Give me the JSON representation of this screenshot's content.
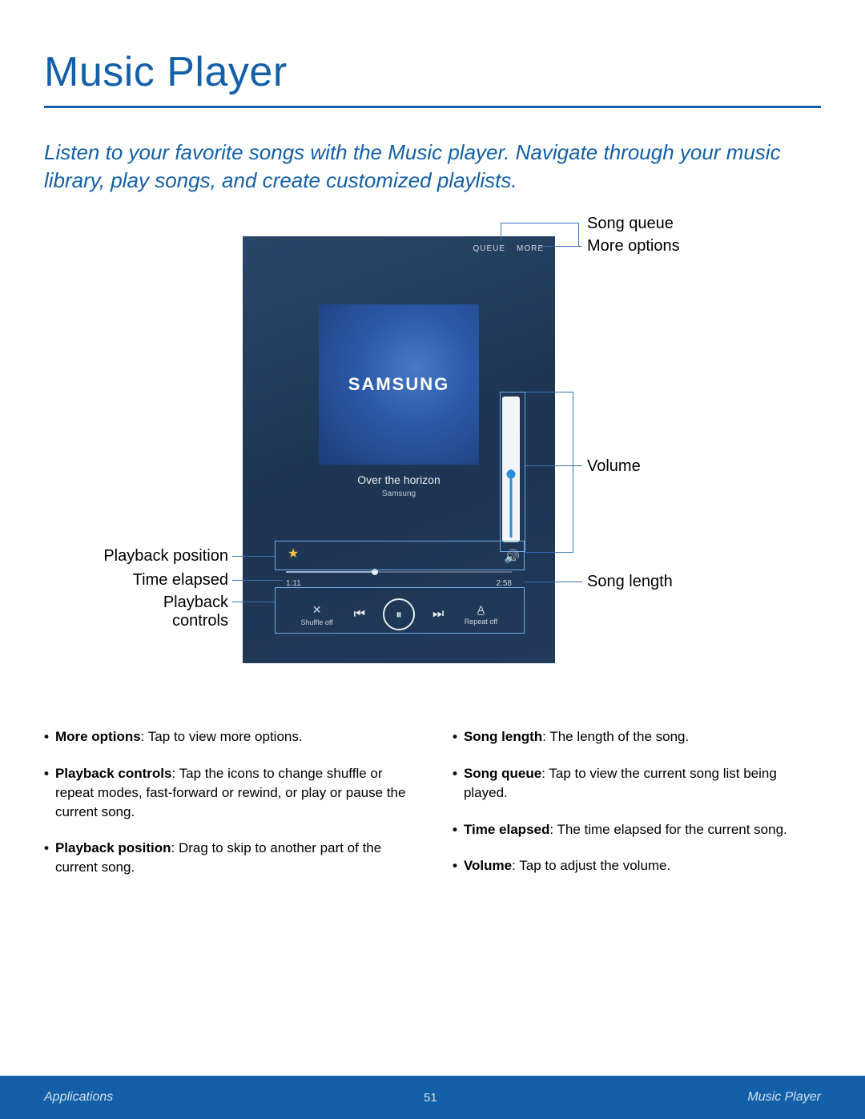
{
  "title": "Music Player",
  "intro": "Listen to your favorite songs with the Music player. Navigate through your music library, play songs, and create customized playlists.",
  "phone": {
    "top": {
      "queue": "QUEUE",
      "more": "MORE"
    },
    "album_brand": "SAMSUNG",
    "song_title": "Over the horizon",
    "song_artist": "Samsung",
    "time_elapsed": "1:11",
    "song_length": "2:58",
    "shuffle_label": "Shuffle off",
    "repeat_label": "Repeat off"
  },
  "callouts": {
    "song_queue": "Song queue",
    "more_options": "More options",
    "volume": "Volume",
    "playback_position": "Playback position",
    "time_elapsed": "Time elapsed",
    "playback_controls": "Playback\ncontrols",
    "song_length": "Song length"
  },
  "descriptions": {
    "left": [
      {
        "term": "More options",
        "text": ": Tap to view more options."
      },
      {
        "term": "Playback controls",
        "text": ": Tap the icons to change shuffle or repeat modes, fast-forward or rewind, or play or pause the current song."
      },
      {
        "term": "Playback position",
        "text": ": Drag to skip to another part of the current song."
      }
    ],
    "right": [
      {
        "term": "Song length",
        "text": ": The length of the song."
      },
      {
        "term": "Song queue",
        "text": ": Tap to view the current song list being played."
      },
      {
        "term": "Time elapsed",
        "text": ": The time elapsed for the current song."
      },
      {
        "term": "Volume",
        "text": ": Tap to adjust the volume."
      }
    ]
  },
  "footer": {
    "left": "Applications",
    "page": "51",
    "right": "Music Player"
  }
}
